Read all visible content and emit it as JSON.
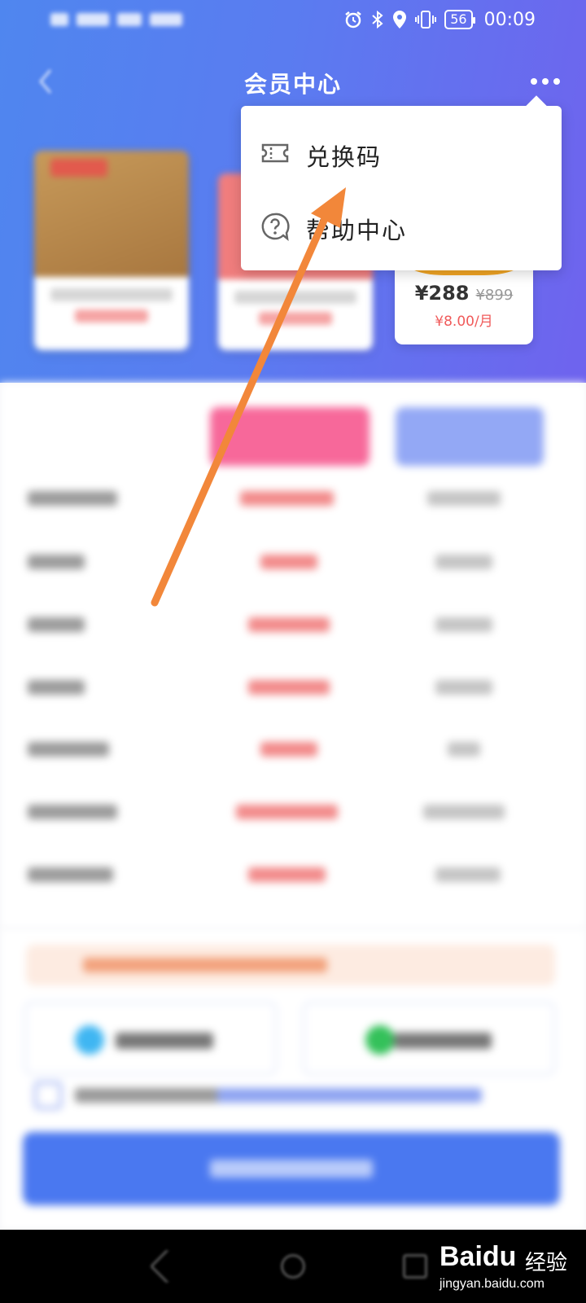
{
  "status_bar": {
    "battery": "56",
    "time": "00:09"
  },
  "header": {
    "title": "会员中心"
  },
  "cards": {
    "card_3": {
      "price": "¥288",
      "original_price": "¥899",
      "per_month": "¥8.00/月"
    }
  },
  "dropdown": {
    "items": [
      {
        "label": "兑换码",
        "icon": "ticket-icon"
      },
      {
        "label": "帮助中心",
        "icon": "help-circle-icon"
      }
    ]
  },
  "watermark": {
    "logo": "Baidu",
    "cn": "经验",
    "url": "jingyan.baidu.com"
  },
  "colors": {
    "header_start": "#4f86ef",
    "header_end": "#6f63ee",
    "annotation_arrow": "#f2873a",
    "price_red": "#f05a5a",
    "primary_button": "#4a78f0"
  }
}
